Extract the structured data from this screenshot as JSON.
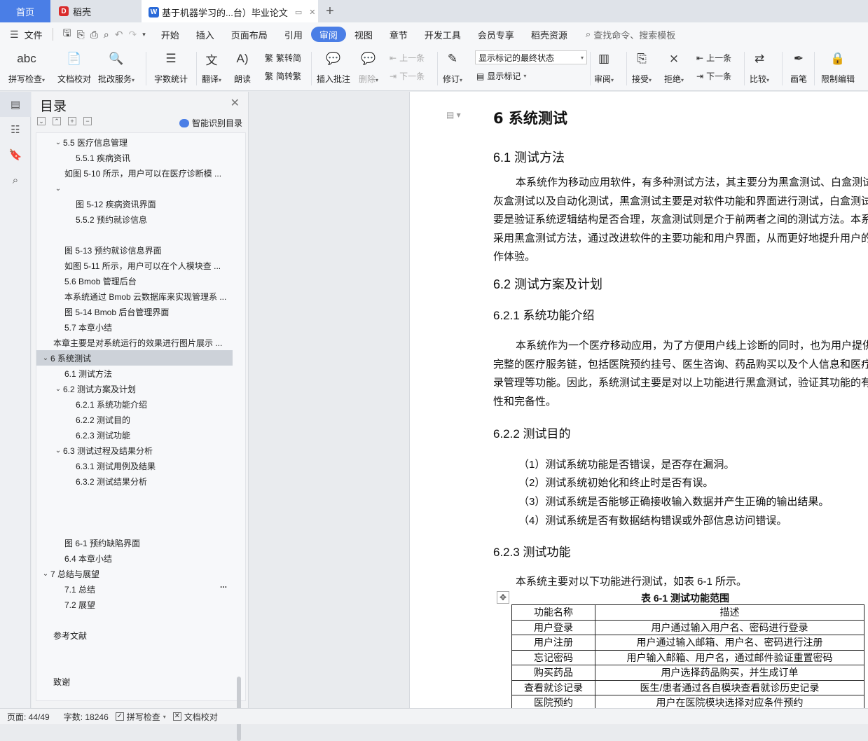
{
  "tabs": {
    "home": "首页",
    "daoke": "稻壳",
    "doc": "基于机器学习的...台）毕业论文"
  },
  "menu": {
    "file": "文件",
    "tabs": [
      "开始",
      "插入",
      "页面布局",
      "引用",
      "审阅",
      "视图",
      "章节",
      "开发工具",
      "会员专享",
      "稻壳资源"
    ],
    "search": "查找命令、搜索模板"
  },
  "ribbon": {
    "spell": "拼写检查",
    "proof": "文档校对",
    "correct": "批改服务",
    "wordcount": "字数统计",
    "translate": "翻译",
    "read": "朗读",
    "trad": "繁转简",
    "simp": "简转繁",
    "insert_comment": "插入批注",
    "delete": "删除",
    "prev_comment": "上一条",
    "next_comment": "下一条",
    "track": "修订",
    "markup_state": "显示标记的最终状态",
    "show_markup": "显示标记",
    "review": "审阅",
    "accept": "接受",
    "reject": "拒绝",
    "prev": "上一条",
    "next": "下一条",
    "compare": "比较",
    "pen": "画笔",
    "restrict": "限制编辑"
  },
  "toc": {
    "title": "目录",
    "smart": "智能识别目录",
    "items": [
      "5.5 医疗信息管理",
      "5.5.1 疾病资讯",
      "如图 5-10 所示，用户可以在医疗诊断模 ...",
      "",
      "图 5-12 疾病资讯界面",
      "5.5.2 预约就诊信息",
      "",
      "图 5-13 预约就诊信息界面",
      "如图 5-11 所示，用户可以在个人模块查 ...",
      "5.6 Bmob 管理后台",
      "本系统通过 Bmob 云数据库来实现管理系 ...",
      "图 5-14 Bmob 后台管理界面",
      "5.7 本章小结",
      "本章主要是对系统运行的效果进行图片展示 ...",
      "6 系统测试",
      "6.1 测试方法",
      "6.2 测试方案及计划",
      "6.2.1 系统功能介绍",
      "6.2.2 测试目的",
      "6.2.3 测试功能",
      "6.3 测试过程及结果分析",
      "6.3.1 测试用例及结果",
      "6.3.2 测试结果分析",
      "图 6-1 预约缺陷界面",
      "6.4 本章小结",
      "7 总结与展望",
      "7.1 总结",
      "7.2 展望",
      "参考文献",
      "致谢"
    ],
    "dots": "..."
  },
  "doc": {
    "h_6": "6 系统测试",
    "h_61": "6.1 测试方法",
    "p1": "本系统作为移动应用软件，有多种测试方法，其主要分为黑盒测试、白盒测试、灰盒测试以及自动化测试，黑盒测试主要是对软件功能和界面进行测试，白盒测试主要是验证系统逻辑结构是否合理，灰盒测试则是介于前两者之间的测试方法。本系统采用黑盒测试方法，通过改进软件的主要功能和用户界面，从而更好地提升用户的操作体验。",
    "h_62": "6.2 测试方案及计划",
    "h_621": "6.2.1 系统功能介绍",
    "p2": "本系统作为一个医疗移动应用，为了方便用户线上诊断的同时，也为用户提供了完整的医疗服务链，包括医院预约挂号、医生咨询、药品购买以及个人信息和医疗记录管理等功能。因此，系统测试主要是对以上功能进行黑盒测试，验证其功能的有效性和完备性。",
    "h_622": "6.2.2 测试目的",
    "list": [
      "（1）测试系统功能是否错误，是否存在漏洞。",
      "（2）测试系统初始化和终止时是否有误。",
      "（3）测试系统是否能够正确接收输入数据并产生正确的输出结果。",
      "（4）测试系统是否有数据结构错误或外部信息访问错误。"
    ],
    "h_623": "6.2.3 测试功能",
    "p3": "本系统主要对以下功能进行测试，如表 6-1 所示。",
    "table_caption": "表 6-1  测试功能范围",
    "table_header": [
      "功能名称",
      "描述"
    ],
    "table_rows": [
      [
        "用户登录",
        "用户通过输入用户名、密码进行登录"
      ],
      [
        "用户注册",
        "用户通过输入邮箱、用户名、密码进行注册"
      ],
      [
        "忘记密码",
        "用户输入邮箱、用户名，通过邮件验证重置密码"
      ],
      [
        "购买药品",
        "用户选择药品购买，并生成订单"
      ],
      [
        "查看就诊记录",
        "医生/患者通过各自模块查看就诊历史记录"
      ],
      [
        "医院预约",
        "用户在医院模块选择对应条件预约"
      ]
    ]
  },
  "status": {
    "page": "页面: 44/49",
    "words": "字数: 18246",
    "spell": "拼写检查",
    "proof": "文档校对"
  }
}
